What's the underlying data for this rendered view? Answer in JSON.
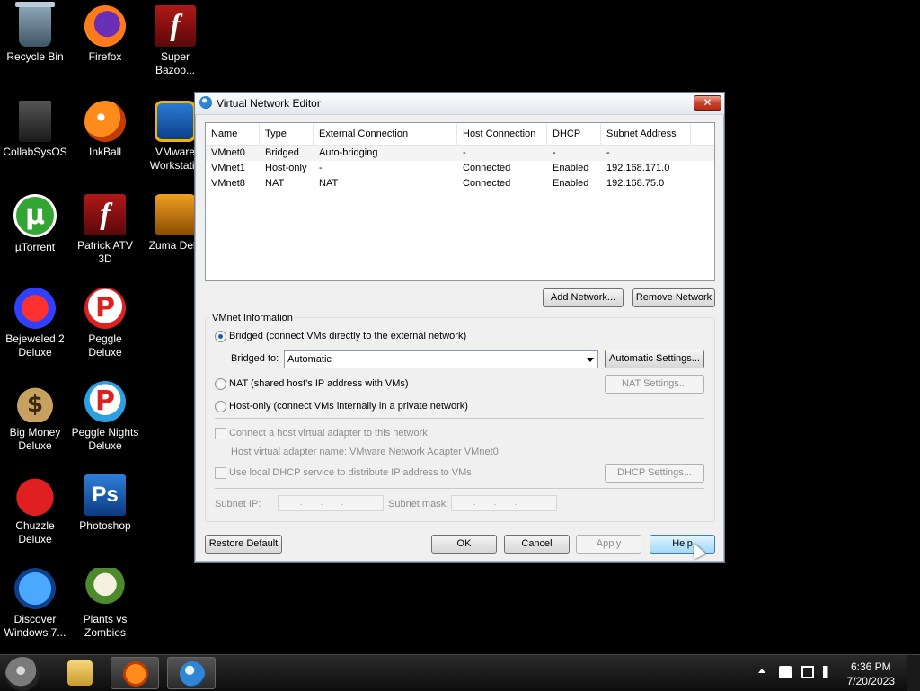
{
  "desktop": {
    "icons": [
      {
        "label": "Recycle Bin"
      },
      {
        "label": "Firefox"
      },
      {
        "label": "Super Bazoo..."
      },
      {
        "label": "CollabSysOS"
      },
      {
        "label": "InkBall"
      },
      {
        "label": "VMware Workstatio"
      },
      {
        "label": "µTorrent"
      },
      {
        "label": "Patrick ATV 3D"
      },
      {
        "label": "Zuma Delu"
      },
      {
        "label": "Bejeweled 2 Deluxe"
      },
      {
        "label": "Peggle Deluxe"
      },
      {
        "label": "Big Money Deluxe"
      },
      {
        "label": "Peggle Nights Deluxe"
      },
      {
        "label": "Chuzzle Deluxe"
      },
      {
        "label": "Photoshop"
      },
      {
        "label": "Discover Windows 7..."
      },
      {
        "label": "Plants vs Zombies"
      }
    ]
  },
  "window": {
    "title": "Virtual Network Editor",
    "close_glyph": "✕",
    "columns": [
      "Name",
      "Type",
      "External Connection",
      "Host Connection",
      "DHCP",
      "Subnet Address"
    ],
    "rows": [
      [
        "VMnet0",
        "Bridged",
        "Auto-bridging",
        "-",
        "-",
        "-"
      ],
      [
        "VMnet1",
        "Host-only",
        "-",
        "Connected",
        "Enabled",
        "192.168.171.0"
      ],
      [
        "VMnet8",
        "NAT",
        "NAT",
        "Connected",
        "Enabled",
        "192.168.75.0"
      ]
    ],
    "add_network": "Add Network...",
    "remove_network": "Remove Network",
    "vmnet_info_title": "VMnet Information",
    "radio_bridged": "Bridged (connect VMs directly to the external network)",
    "bridged_to_label": "Bridged to:",
    "bridged_to_value": "Automatic",
    "automatic_settings": "Automatic Settings...",
    "radio_nat": "NAT (shared host's IP address with VMs)",
    "nat_settings": "NAT Settings...",
    "radio_hostonly": "Host-only (connect VMs internally in a private network)",
    "check_connect_adapter": "Connect a host virtual adapter to this network",
    "adapter_name": "Host virtual adapter name: VMware Network Adapter VMnet0",
    "check_dhcp": "Use local DHCP service to distribute IP address to VMs",
    "dhcp_settings": "DHCP Settings...",
    "subnet_ip_label": "Subnet IP:",
    "subnet_mask_label": "Subnet mask:",
    "ip_placeholder": "...",
    "restore_default": "Restore Default",
    "ok": "OK",
    "cancel": "Cancel",
    "apply": "Apply",
    "help": "Help"
  },
  "taskbar": {
    "time": "6:36 PM",
    "date": "7/20/2023"
  }
}
